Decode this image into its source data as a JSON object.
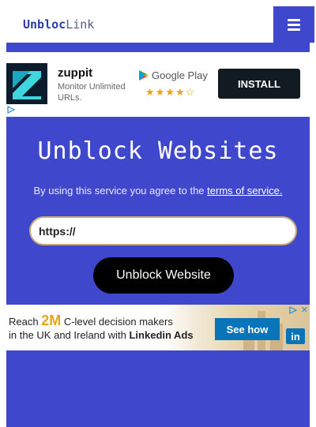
{
  "header": {
    "logo_part1": "Unbloc",
    "logo_part2": "Link",
    "menu_icon": "hamburger-icon"
  },
  "ad_top": {
    "app_name": "zuppit",
    "app_description": "Monitor Unlimited URLs.",
    "store_label": "Google Play",
    "rating_stars": "★★★★☆",
    "rating_value": 4.5,
    "install_label": "INSTALL",
    "icon": "zuppit-app-icon"
  },
  "main": {
    "title": "Unblock Websites",
    "terms_prefix": "By using this service you agree to the ",
    "terms_link": "terms of service.",
    "url_value": "https://",
    "submit_label": "Unblock Website"
  },
  "ad_bottom": {
    "line1_prefix": "Reach ",
    "line1_highlight": "2M",
    "line1_suffix": " C-level decision makers",
    "line2_prefix": "in the UK and Ireland with ",
    "line2_bold": "Linkedin Ads",
    "cta_label": "See how",
    "badge_label": "in",
    "close_label": "✕",
    "adchoices_icon": "adchoices-icon"
  },
  "colors": {
    "primary_blue": "#3f48cc",
    "button_black": "#000000",
    "install_dark": "#121a22",
    "linkedin_blue": "#0a74b8",
    "highlight_orange": "#e8a317"
  }
}
